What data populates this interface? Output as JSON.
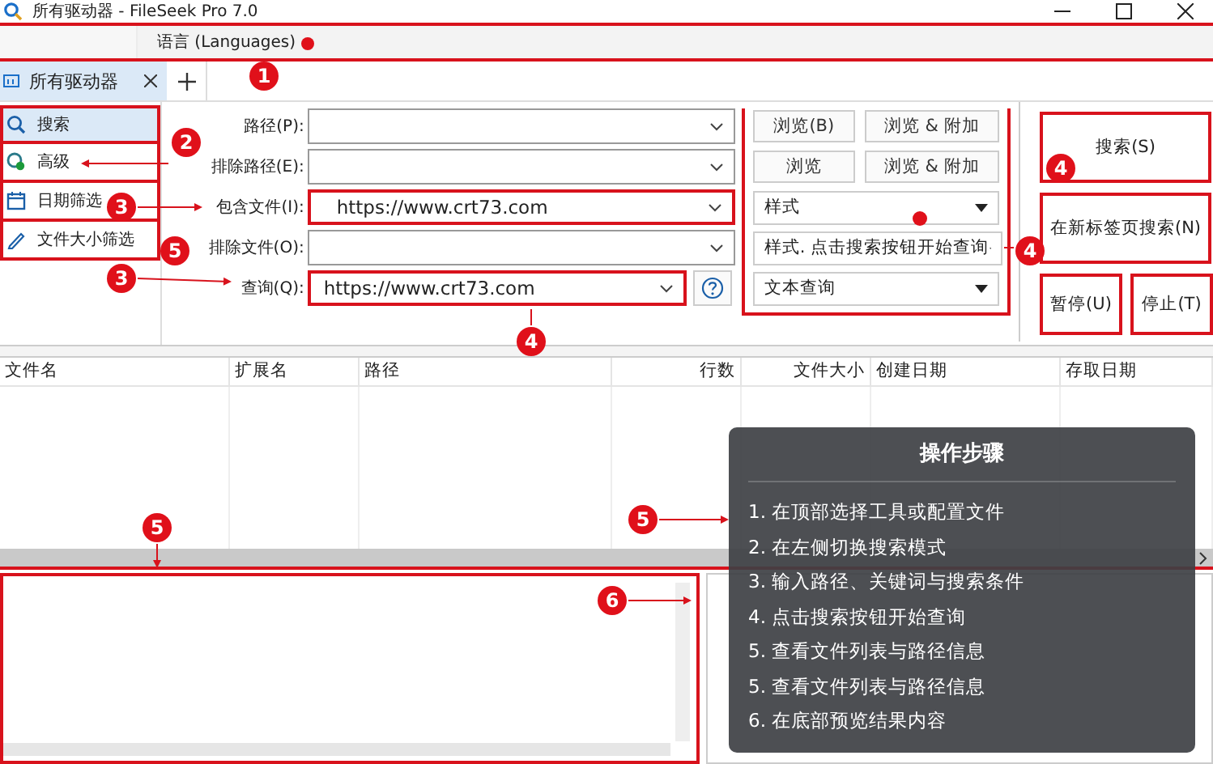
{
  "window": {
    "title": "所有驱动器 - FileSeek Pro 7.0"
  },
  "menu": {
    "items": [
      {
        "label": "语言 (Languages)"
      }
    ]
  },
  "tabs": [
    {
      "label": "所有驱动器",
      "selected": true
    }
  ],
  "sidebar": {
    "items": [
      {
        "label": "搜索",
        "selected": true
      },
      {
        "label": "高级",
        "selected": false
      },
      {
        "label": "日期筛选",
        "selected": false
      },
      {
        "label": "文件大小筛选",
        "selected": false
      }
    ]
  },
  "form": {
    "fields": [
      {
        "label": "路径(P):",
        "highlighted": false,
        "buttons": [
          "浏览(B)",
          "浏览 & 附加"
        ]
      },
      {
        "label": "排除路径(E):",
        "highlighted": false,
        "buttons": [
          "浏览",
          "浏览 & 附加"
        ]
      },
      {
        "label": "包含文件(I):",
        "value": "https://www.crt73.com",
        "highlighted": true,
        "dropdown": "样式"
      },
      {
        "label": "排除文件(O):",
        "highlighted": false,
        "dropdown": "样式. 点击搜索按钮开始查询"
      },
      {
        "label": "查询(Q):",
        "value": "https://www.crt73.com",
        "highlighted": true,
        "help": true,
        "dropdown": "文本查询"
      }
    ]
  },
  "actions": [
    {
      "label": "搜索(S)"
    },
    {
      "label": "在新标签页搜索(N)"
    },
    {
      "label": "暂停(U)"
    },
    {
      "label": "停止(T)"
    }
  ],
  "table": {
    "columns": [
      {
        "label": "文件名"
      },
      {
        "label": "扩展名"
      },
      {
        "label": "路径"
      },
      {
        "label": "行数"
      },
      {
        "label": "文件大小"
      },
      {
        "label": "创建日期"
      },
      {
        "label": "存取日期"
      }
    ]
  },
  "guide": {
    "title": "操作步骤",
    "steps": [
      "1. 在顶部选择工具或配置文件",
      "2. 在左侧切换搜索模式",
      "3. 输入路径、关键词与搜索条件",
      "4. 点击搜索按钮开始查询",
      "5. 查看文件列表与路径信息",
      "5. 查看文件列表与路径信息",
      "6. 在底部预览结果内容"
    ]
  },
  "annotations": [
    {
      "number": "1"
    },
    {
      "number": "2"
    },
    {
      "number": "3"
    },
    {
      "number": "5"
    },
    {
      "number": "3"
    },
    {
      "number": "4"
    },
    {
      "number": "4"
    },
    {
      "number": "4"
    },
    {
      "number": "5"
    },
    {
      "number": "5"
    },
    {
      "number": "6"
    }
  ]
}
